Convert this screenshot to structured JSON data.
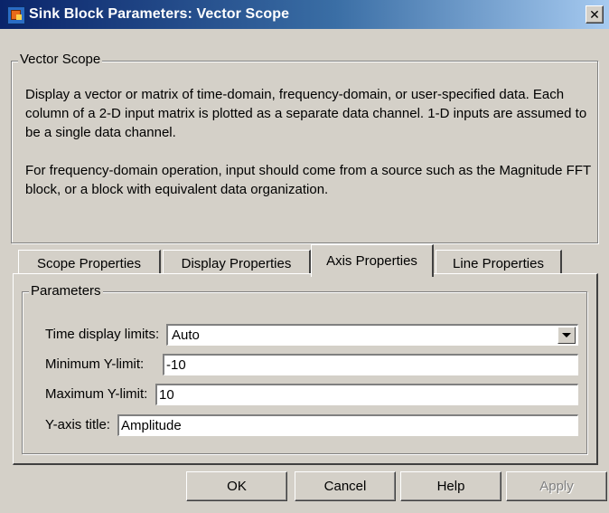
{
  "window": {
    "title": "Sink Block Parameters: Vector Scope",
    "close_glyph": "✕"
  },
  "description": {
    "group_label": "Vector Scope",
    "paragraph1": "Display a vector or matrix of time-domain, frequency-domain, or user-specified data. Each column of a 2-D input matrix is plotted as a separate data channel.  1-D inputs are assumed to be a single data channel.",
    "paragraph2": "For frequency-domain operation, input should come from a source such as the Magnitude FFT block, or a block with equivalent data organization."
  },
  "tabs": [
    {
      "label": "Scope Properties",
      "active": false
    },
    {
      "label": "Display Properties",
      "active": false
    },
    {
      "label": "Axis Properties",
      "active": true
    },
    {
      "label": "Line Properties",
      "active": false
    }
  ],
  "parameters": {
    "group_label": "Parameters",
    "time_display_limits": {
      "label": "Time display limits:",
      "value": "Auto"
    },
    "min_y_limit": {
      "label": "Minimum Y-limit:",
      "value": "-10"
    },
    "max_y_limit": {
      "label": "Maximum Y-limit:",
      "value": "10"
    },
    "y_axis_title": {
      "label": "Y-axis title:",
      "value": "Amplitude"
    }
  },
  "buttons": {
    "ok": "OK",
    "cancel": "Cancel",
    "help": "Help",
    "apply": "Apply"
  },
  "colors": {
    "titlebar_start": "#0a246a",
    "titlebar_end": "#a6caf0",
    "face": "#d4d0c8"
  },
  "icons": {
    "app": "simulink-block-icon",
    "close": "close-icon",
    "dropdown": "chevron-down-icon"
  }
}
